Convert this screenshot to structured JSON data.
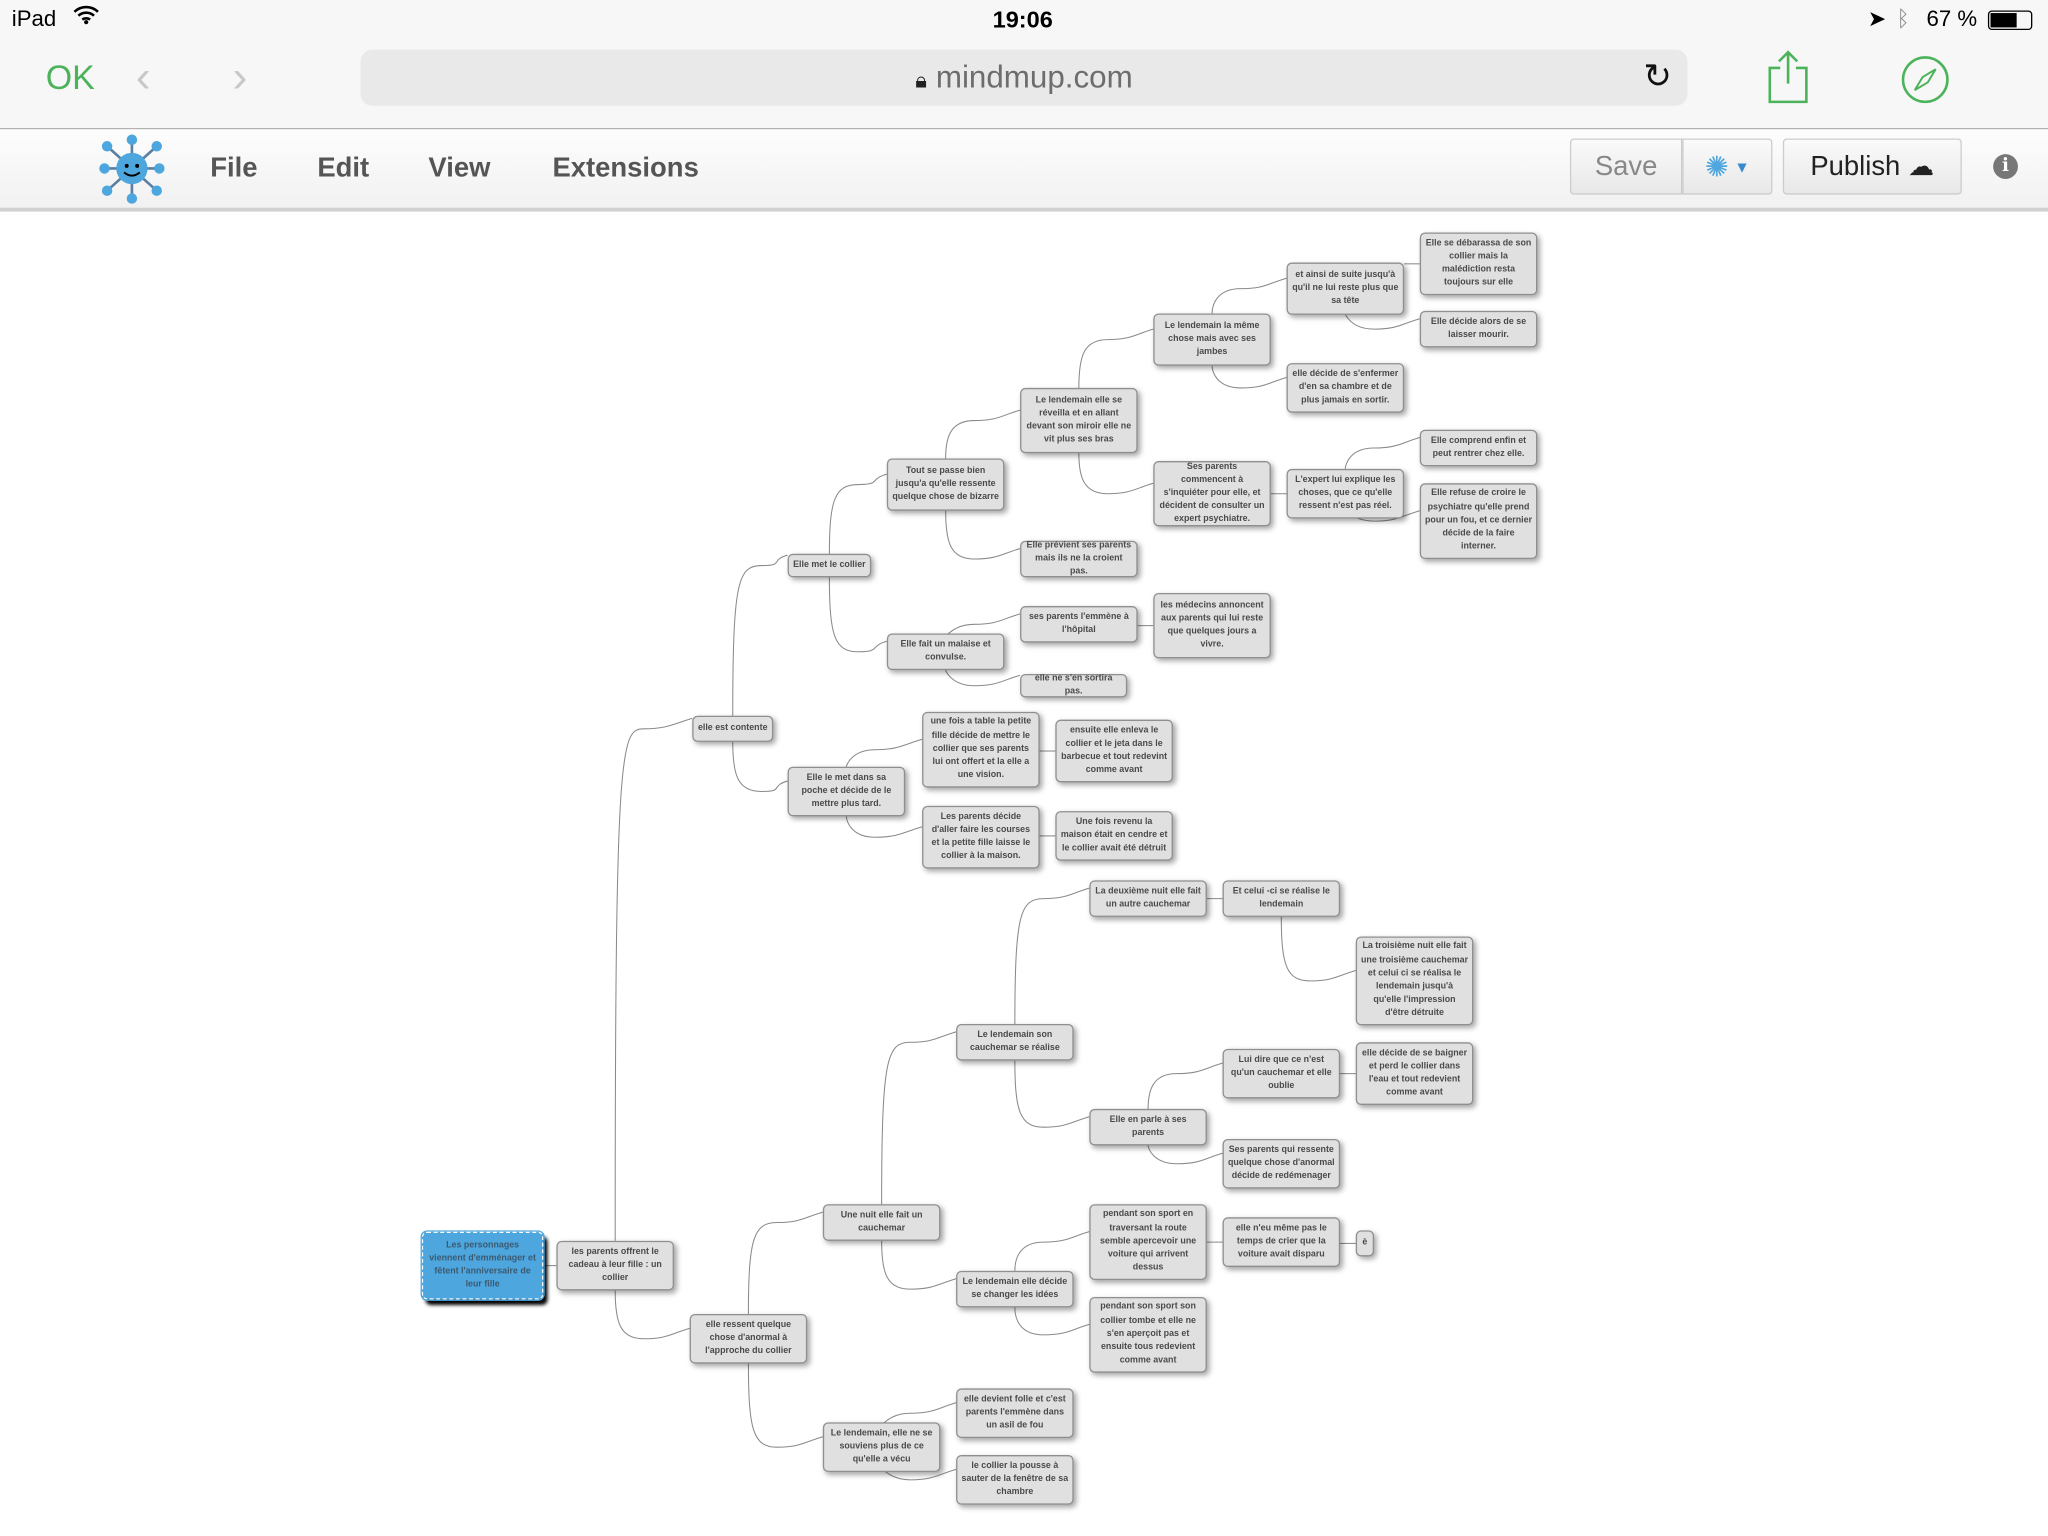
{
  "status_bar": {
    "device": "iPad",
    "time": "19:06",
    "battery": "67 %",
    "icons": [
      "wifi-icon",
      "location-icon",
      "bluetooth-icon",
      "battery-icon"
    ]
  },
  "browser": {
    "done_label": "OK",
    "url": "mindmup.com",
    "icons": [
      "back-icon",
      "forward-icon",
      "lock-icon",
      "reload-icon",
      "share-icon",
      "compass-icon"
    ]
  },
  "app": {
    "menu": {
      "file": "File",
      "edit": "Edit",
      "view": "View",
      "extensions": "Extensions"
    },
    "save_label": "Save",
    "publish_label": "Publish",
    "accent_color": "#4ea6de"
  },
  "mindmap": {
    "nodes": [
      {
        "id": "root",
        "parent": null,
        "text": "Les personnages viennent d'emménager et fêtent l'anniversaire de leur fille",
        "selected": true
      },
      {
        "id": "n1",
        "parent": "root",
        "text": "les parents offrent le cadeau à leur fille : un collier"
      },
      {
        "id": "n2",
        "parent": "n1",
        "text": "elle est contente"
      },
      {
        "id": "n3",
        "parent": "n2",
        "text": "Elle met le collier"
      },
      {
        "id": "n4",
        "parent": "n3",
        "text": "Tout se passe bien jusqu'a qu'elle ressente quelque chose de bizarre"
      },
      {
        "id": "n5",
        "parent": "n4",
        "text": "Le lendemain elle se réveilla et en allant devant son miroir elle ne vit plus ses bras"
      },
      {
        "id": "n6",
        "parent": "n5",
        "text": "Le lendemain la même chose mais avec ses jambes"
      },
      {
        "id": "n7",
        "parent": "n6",
        "text": "et ainsi de suite jusqu'à qu'il ne lui reste plus que sa tête"
      },
      {
        "id": "n8",
        "parent": "n7",
        "text": "Elle se débarassa de son collier mais la malédiction resta toujours sur elle"
      },
      {
        "id": "n9",
        "parent": "n7",
        "text": "Elle décide alors de se laisser mourir."
      },
      {
        "id": "n10",
        "parent": "n6",
        "text": "elle décide de s'enfermer d'en sa chambre et de plus jamais en sortir."
      },
      {
        "id": "n11",
        "parent": "n5",
        "text": "Ses parents commencent à s'inquiéter pour elle, et décident de consulter un expert psychiatre."
      },
      {
        "id": "n12",
        "parent": "n11",
        "text": "L'expert lui explique les choses, que ce qu'elle ressent n'est pas réel."
      },
      {
        "id": "n13",
        "parent": "n12",
        "text": "Elle comprend enfin et peut rentrer chez elle."
      },
      {
        "id": "n14",
        "parent": "n12",
        "text": "Elle refuse de croire le psychiatre qu'elle prend pour un fou, et ce dernier décide de la faire interner."
      },
      {
        "id": "n15",
        "parent": "n4",
        "text": "Elle prévient ses parents mais ils ne la croient pas."
      },
      {
        "id": "n16",
        "parent": "n3",
        "text": "Elle fait un malaise et convulse."
      },
      {
        "id": "n17",
        "parent": "n16",
        "text": "ses parents l'emmène à l'hôpital"
      },
      {
        "id": "n18",
        "parent": "n17",
        "text": "les médecins annoncent aux parents qui lui reste que quelques jours a vivre."
      },
      {
        "id": "n19",
        "parent": "n16",
        "text": "elle ne s'en sortira pas."
      },
      {
        "id": "n20",
        "parent": "n2",
        "text": "Elle le met dans sa poche et décide de le mettre plus tard."
      },
      {
        "id": "n21",
        "parent": "n20",
        "text": "une fois a table la petite fille décide de mettre le collier que ses parents lui ont offert et la elle a une vision."
      },
      {
        "id": "n22",
        "parent": "n21",
        "text": "ensuite elle enleva le collier et le jeta dans le barbecue et tout redevint comme avant"
      },
      {
        "id": "n23",
        "parent": "n20",
        "text": "Les parents décide d'aller  faire les courses et la petite fille laisse le collier à la maison."
      },
      {
        "id": "n24",
        "parent": "n23",
        "text": "Une fois revenu la maison était en cendre et le collier avait été détruit"
      },
      {
        "id": "n25",
        "parent": "n1",
        "text": "elle ressent quelque chose d'anormal à l'approche du collier"
      },
      {
        "id": "n26",
        "parent": "n25",
        "text": "Une nuit elle fait un cauchemar"
      },
      {
        "id": "n27",
        "parent": "n26",
        "text": "Le lendemain son cauchemar se réalise"
      },
      {
        "id": "n28",
        "parent": "n27",
        "text": "La deuxième nuit elle fait un autre cauchemar"
      },
      {
        "id": "n29",
        "parent": "n28",
        "text": "Et celui -ci se réalise le lendemain"
      },
      {
        "id": "n30",
        "parent": "n29",
        "text": "La troisième nuit elle fait une troisième cauchemar et celui ci se réalisa le lendemain jusqu'à qu'elle l'impression d'être détruite"
      },
      {
        "id": "n31",
        "parent": "n27",
        "text": "Elle en parle à ses parents"
      },
      {
        "id": "n32",
        "parent": "n31",
        "text": "Lui dire que ce n'est qu'un cauchemar et elle oublie"
      },
      {
        "id": "n33",
        "parent": "n32",
        "text": "elle décide de se baigner et perd le collier dans l'eau et tout redevient comme avant"
      },
      {
        "id": "n34",
        "parent": "n31",
        "text": "Ses parents qui ressente quelque chose d'anormal décide de redémenager"
      },
      {
        "id": "n35",
        "parent": "n26",
        "text": "Le lendemain elle décide se changer les idées"
      },
      {
        "id": "n36",
        "parent": "n35",
        "text": "pendant son sport en traversant la route semble apercevoir une voiture qui arrivent dessus"
      },
      {
        "id": "n37",
        "parent": "n36",
        "text": "elle n'eu  même pas le temps de crier que la voiture avait disparu"
      },
      {
        "id": "n38",
        "parent": "n37",
        "text": "è"
      },
      {
        "id": "n39",
        "parent": "n35",
        "text": "pendant son sport son collier tombe et elle ne s'en aperçoit pas et ensuite tous redevient comme avant"
      },
      {
        "id": "n40",
        "parent": "n25",
        "text": "Le lendemain, elle ne se souviens plus de ce qu'elle a vécu"
      },
      {
        "id": "n41",
        "parent": "n40",
        "text": "elle devient folle et c'est parents l'emmène dans un asil de fou"
      },
      {
        "id": "n42",
        "parent": "n40",
        "text": "le collier la pousse à sauter de la fenêtre de sa chambre"
      }
    ]
  }
}
